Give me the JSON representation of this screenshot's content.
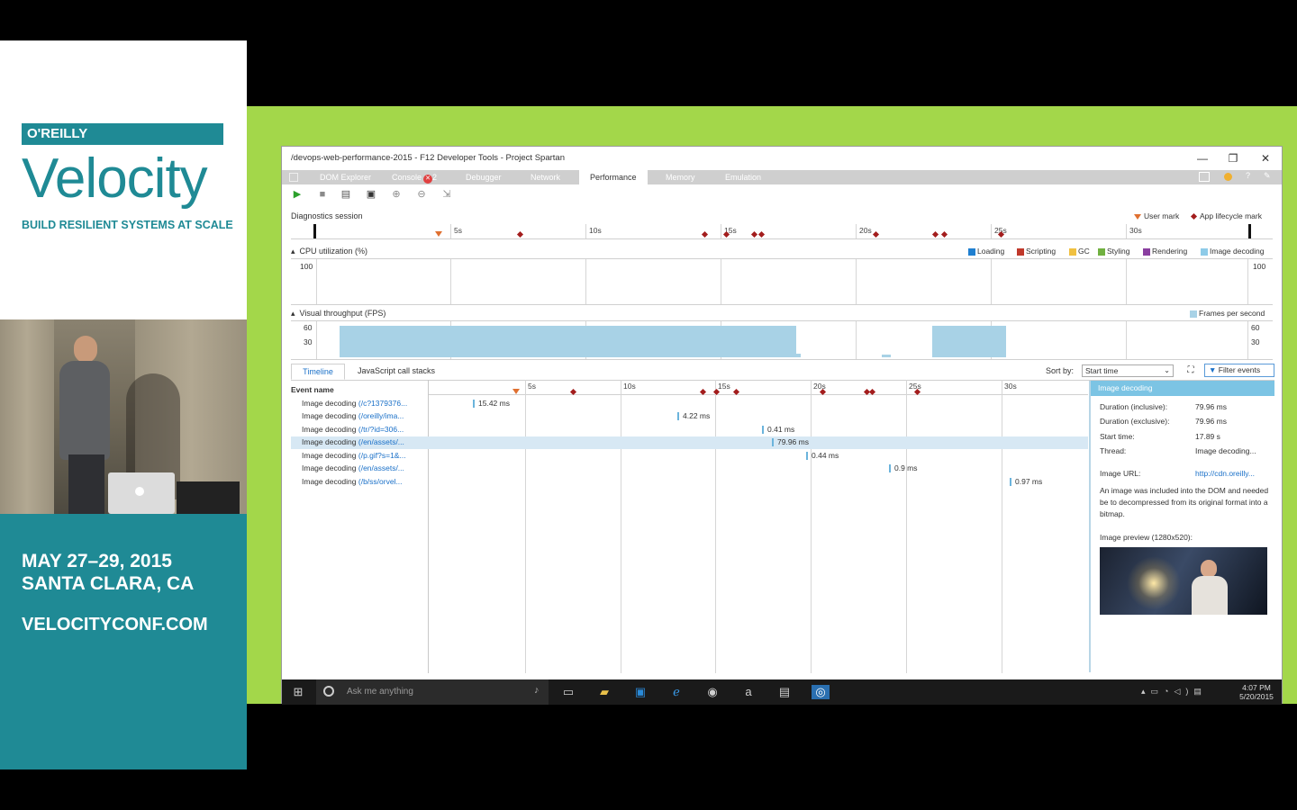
{
  "conference": {
    "publisher": "O'REILLY",
    "name": "Velocity",
    "tagline": "BUILD RESILIENT SYSTEMS AT SCALE",
    "dates": "MAY 27–29, 2015",
    "location": "SANTA CLARA, CA",
    "website": "VELOCITYCONF.COM"
  },
  "window": {
    "title": "/devops-web-performance-2015 - F12 Developer Tools - Project Spartan",
    "minimize": "—",
    "restore": "❐",
    "close": "✕"
  },
  "tabs": [
    {
      "label": "DOM Explorer"
    },
    {
      "label": "Console"
    },
    {
      "label": "Debugger"
    },
    {
      "label": "Network"
    },
    {
      "label": "Performance"
    },
    {
      "label": "Memory"
    },
    {
      "label": "Emulation"
    }
  ],
  "console_error_count": "2",
  "toolbar": {
    "start_icon": "play-icon",
    "stop_icon": "stop-icon",
    "import_icon": "open-folder-icon",
    "save_icon": "save-icon",
    "zoom_in_icon": "zoom-in-icon",
    "zoom_out_icon": "zoom-out-icon",
    "reset_zoom_icon": "reset-zoom-icon"
  },
  "diagnostics": {
    "label": "Diagnostics session",
    "legend_user_mark": "User mark",
    "legend_app_mark": "App lifecycle mark",
    "ticks": [
      "5s",
      "10s",
      "15s",
      "20s",
      "25s",
      "30s"
    ]
  },
  "cpu": {
    "label": "CPU utilization (%)",
    "scale_top": "100",
    "legend": [
      {
        "name": "Loading",
        "color": "#1f7fd0"
      },
      {
        "name": "Scripting",
        "color": "#c0392b"
      },
      {
        "name": "GC",
        "color": "#f0c040"
      },
      {
        "name": "Styling",
        "color": "#70b040"
      },
      {
        "name": "Rendering",
        "color": "#8a3fa0"
      },
      {
        "name": "Image decoding",
        "color": "#8ecbe8"
      }
    ]
  },
  "fps": {
    "label": "Visual throughput (FPS)",
    "legend": "Frames per second",
    "scale_60": "60",
    "scale_30": "30",
    "bar_color": "#a8d2e6"
  },
  "timeline": {
    "tab_timeline": "Timeline",
    "tab_callstacks": "JavaScript call stacks",
    "sort_by_label": "Sort by:",
    "sort_value": "Start time",
    "filter_label": "Filter events",
    "event_name_header": "Event name",
    "ticks": [
      "5s",
      "10s",
      "15s",
      "20s",
      "25s",
      "30s"
    ],
    "rows": [
      {
        "name": "Image decoding",
        "url": "(/c?1379376...",
        "duration": "15.42 ms"
      },
      {
        "name": "Image decoding",
        "url": "(/oreilly/ima...",
        "duration": "4.22 ms"
      },
      {
        "name": "Image decoding",
        "url": "(/tr/?id=306...",
        "duration": "0.41 ms"
      },
      {
        "name": "Image decoding",
        "url": "(/en/assets/...",
        "duration": "79.96 ms"
      },
      {
        "name": "Image decoding",
        "url": "(/p.gif?s=1&...",
        "duration": "0.44 ms"
      },
      {
        "name": "Image decoding",
        "url": "(/en/assets/...",
        "duration": "0.9 ms"
      },
      {
        "name": "Image decoding",
        "url": "(/b/ss/orvel...",
        "duration": "0.97 ms"
      }
    ]
  },
  "details": {
    "header": "Image decoding",
    "duration_incl_label": "Duration (inclusive):",
    "duration_incl": "79.96 ms",
    "duration_excl_label": "Duration (exclusive):",
    "duration_excl": "79.96 ms",
    "start_time_label": "Start time:",
    "start_time": "17.89 s",
    "thread_label": "Thread:",
    "thread": "Image decoding...",
    "image_url_label": "Image URL:",
    "image_url": "http://cdn.oreilly...",
    "description": "An image was included into the DOM and needed be to decompressed from its original format into a bitmap.",
    "preview_label": "Image preview (1280x520):"
  },
  "taskbar": {
    "search_placeholder": "Ask me anything",
    "time": "4:07 PM",
    "date": "5/20/2015"
  }
}
